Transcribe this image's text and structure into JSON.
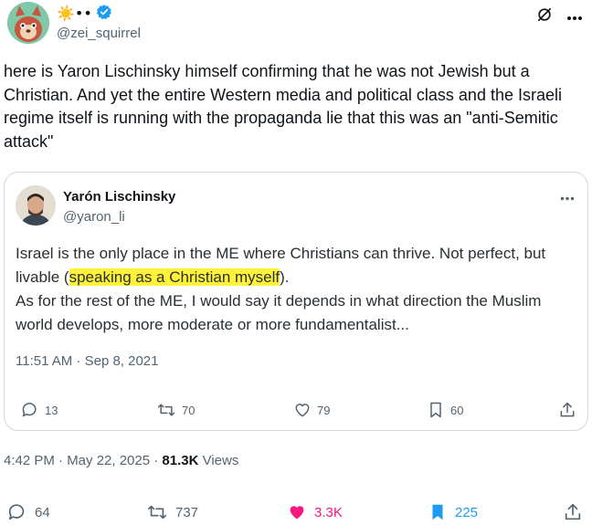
{
  "author": {
    "handle": "@zei_squirrel",
    "emoji_status": "☀️••"
  },
  "tweet": {
    "text": "here is Yaron Lischinsky himself confirming that he was not Jewish but a Christian. And yet the entire Western media and political class and the Israeli regime itself is running with the propaganda lie that this was an \"anti-Semitic attack\""
  },
  "quoted": {
    "name": "Yarón Lischinsky",
    "handle": "@yaron_li",
    "text_before": "Israel is the only place in the ME where Christians can thrive. Not perfect, but livable (",
    "text_highlight": "speaking as a Christian myself",
    "text_after": ").",
    "text_line2": "As for the rest of the ME, I would say it depends in what direction the Muslim world develops, more moderate or more fundamentalist...",
    "timestamp": "11:51 AM · Sep 8, 2021",
    "replies": "13",
    "retweets": "70",
    "likes": "79",
    "bookmarks": "60"
  },
  "meta": {
    "time": "4:42 PM · May 22, 2025 · ",
    "views_count": "81.3K",
    "views_label": " Views"
  },
  "actions": {
    "replies": "64",
    "retweets": "737",
    "likes": "3.3K",
    "bookmarks": "225"
  },
  "colors": {
    "like_active": "#f91880",
    "bookmark_active": "#1d9bf0",
    "verified": "#1d9bf0",
    "highlight": "#fff33a"
  }
}
